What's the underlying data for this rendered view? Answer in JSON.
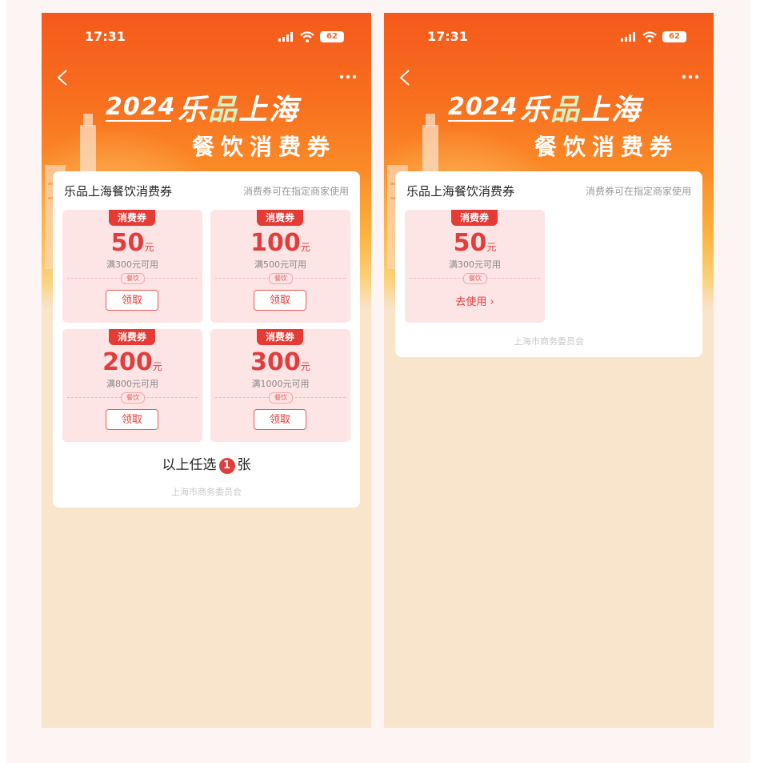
{
  "status": {
    "time": "17:31",
    "battery": "62"
  },
  "banner": {
    "year": "2024",
    "brand_left": "乐",
    "brand_mid": "品",
    "brand_right": "上海",
    "subtitle": "餐饮消费券"
  },
  "card": {
    "title": "乐品上海餐饮消费券",
    "note": "消费券可在指定商家使用",
    "footer": "上海市商务委员会"
  },
  "colors": {
    "accent": "#e23d3d",
    "banner_orange": "#f86f1e",
    "page_bg": "#f9e4cc"
  },
  "left_screen": {
    "coupons": [
      {
        "tag": "消费券",
        "amount": "50",
        "unit": "元",
        "condition": "满300元可用",
        "category": "餐饮",
        "action": "领取"
      },
      {
        "tag": "消费券",
        "amount": "100",
        "unit": "元",
        "condition": "满500元可用",
        "category": "餐饮",
        "action": "领取"
      },
      {
        "tag": "消费券",
        "amount": "200",
        "unit": "元",
        "condition": "满800元可用",
        "category": "餐饮",
        "action": "领取"
      },
      {
        "tag": "消费券",
        "amount": "300",
        "unit": "元",
        "condition": "满1000元可用",
        "category": "餐饮",
        "action": "领取"
      }
    ],
    "select_prefix": "以上任选",
    "select_count": "1",
    "select_suffix": "张"
  },
  "right_screen": {
    "coupon": {
      "tag": "消费券",
      "amount": "50",
      "unit": "元",
      "condition": "满300元可用",
      "category": "餐饮",
      "action": "去使用 ›"
    }
  }
}
